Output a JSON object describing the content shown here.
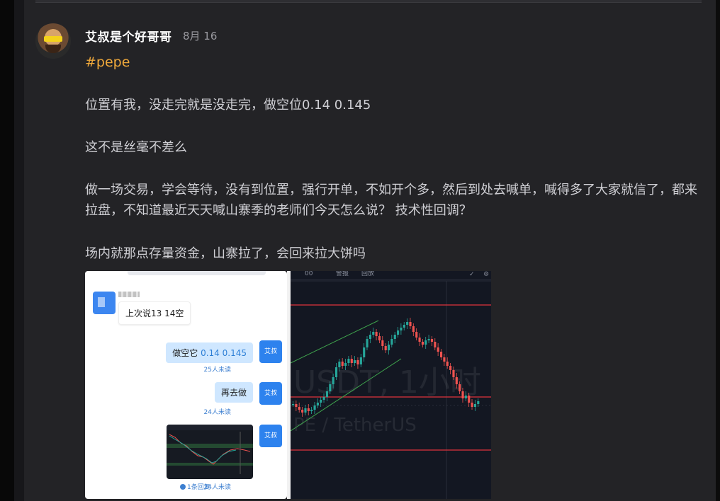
{
  "post": {
    "author": "艾叔是个好哥哥",
    "date": "8月 16",
    "tag": "#pepe",
    "paragraphs": [
      "位置有我，没走完就是没走完，做空位0.14 0.145",
      "这不是丝毫不差么",
      "做一场交易，学会等待，没有到位置，强行开单，不如开个多，然后到处去喊单，喊得多了大家就信了，都来拉盘，不知道最近天天喊山寨季的老师们今天怎么说？ 技术性回调？",
      "场内就那点存量资金，山寨拉了，会回来拉大饼吗"
    ]
  },
  "chat_image": {
    "left_message": "上次说13  14空",
    "msg1_prefix": "做空它 ",
    "msg1_numbers": "0.14   0.145",
    "msg2": "再去做",
    "sender_label": "艾叔",
    "read1": "25人未读",
    "read2": "24人未读",
    "read3": "24人未读",
    "reply": "1条回复"
  },
  "trade_image": {
    "watermark_pair": "USDT, 1小时",
    "watermark_name": "PE / TetherUS",
    "toolbar_texts": [
      "00",
      "警报",
      "回放"
    ],
    "colors": {
      "up": "#26a69a",
      "down": "#ef5350",
      "level": "#e0323c",
      "trend": "#3fa34d",
      "bg": "#131722"
    }
  }
}
